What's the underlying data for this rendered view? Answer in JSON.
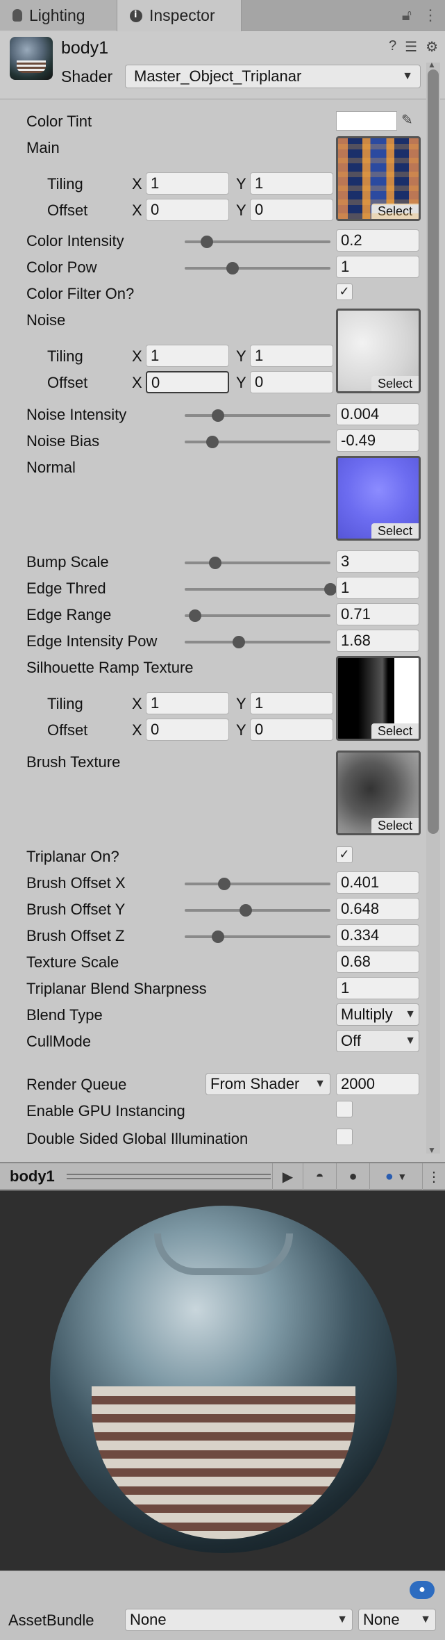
{
  "tabs": [
    {
      "label": "Lighting"
    },
    {
      "label": "Inspector"
    }
  ],
  "header": {
    "object_name": "body1",
    "shader_label": "Shader",
    "shader_value": "Master_Object_Triplanar"
  },
  "props": {
    "color_tint": "Color Tint",
    "main": "Main",
    "tiling": "Tiling",
    "offset": "Offset",
    "x": "X",
    "y": "Y",
    "main_tiling_x": "1",
    "main_tiling_y": "1",
    "main_offset_x": "0",
    "main_offset_y": "0",
    "color_intensity": "Color Intensity",
    "color_intensity_val": "0.2",
    "color_pow": "Color Pow",
    "color_pow_val": "1",
    "color_filter_on": "Color Filter On?",
    "noise": "Noise",
    "noise_tiling_x": "1",
    "noise_tiling_y": "1",
    "noise_offset_x": "0",
    "noise_offset_y": "0",
    "noise_intensity": "Noise Intensity",
    "noise_intensity_val": "0.004",
    "noise_bias": "Noise Bias",
    "noise_bias_val": "-0.49",
    "normal": "Normal",
    "bump_scale": "Bump Scale",
    "bump_scale_val": "3",
    "edge_thred": "Edge Thred",
    "edge_thred_val": "1",
    "edge_range": "Edge Range",
    "edge_range_val": "0.71",
    "edge_intensity_pow": "Edge Intensity Pow",
    "edge_intensity_pow_val": "1.68",
    "silhouette_ramp": "Silhouette Ramp Texture",
    "ramp_tiling_x": "1",
    "ramp_tiling_y": "1",
    "ramp_offset_x": "0",
    "ramp_offset_y": "0",
    "brush_texture": "Brush Texture",
    "triplanar_on": "Triplanar On?",
    "brush_offset_x": "Brush Offset X",
    "brush_offset_x_val": "0.401",
    "brush_offset_y": "Brush Offset Y",
    "brush_offset_y_val": "0.648",
    "brush_offset_z": "Brush Offset Z",
    "brush_offset_z_val": "0.334",
    "texture_scale": "Texture Scale",
    "texture_scale_val": "0.68",
    "triplanar_blend": "Triplanar Blend Sharpness",
    "triplanar_blend_val": "1",
    "blend_type": "Blend Type",
    "blend_type_val": "Multiply",
    "cull_mode": "CullMode",
    "cull_mode_val": "Off",
    "render_queue": "Render Queue",
    "render_queue_mode": "From Shader",
    "render_queue_val": "2000",
    "gpu_instancing": "Enable GPU Instancing",
    "double_sided_gi": "Double Sided Global Illumination",
    "select": "Select",
    "check": "✓"
  },
  "sliders": {
    "color_intensity": 0.15,
    "color_pow": 0.33,
    "noise_intensity": 0.23,
    "noise_bias": 0.19,
    "bump_scale": 0.21,
    "edge_thred": 1.0,
    "edge_range": 0.07,
    "edge_intensity_pow": 0.37,
    "brush_offset_x": 0.27,
    "brush_offset_y": 0.42,
    "brush_offset_z": 0.23
  },
  "preview": {
    "title": "body1"
  },
  "footer": {
    "assetbundle_label": "AssetBundle",
    "bundle_name": "None",
    "bundle_variant": "None"
  },
  "colors": {
    "color_tint": "#ffffff"
  }
}
